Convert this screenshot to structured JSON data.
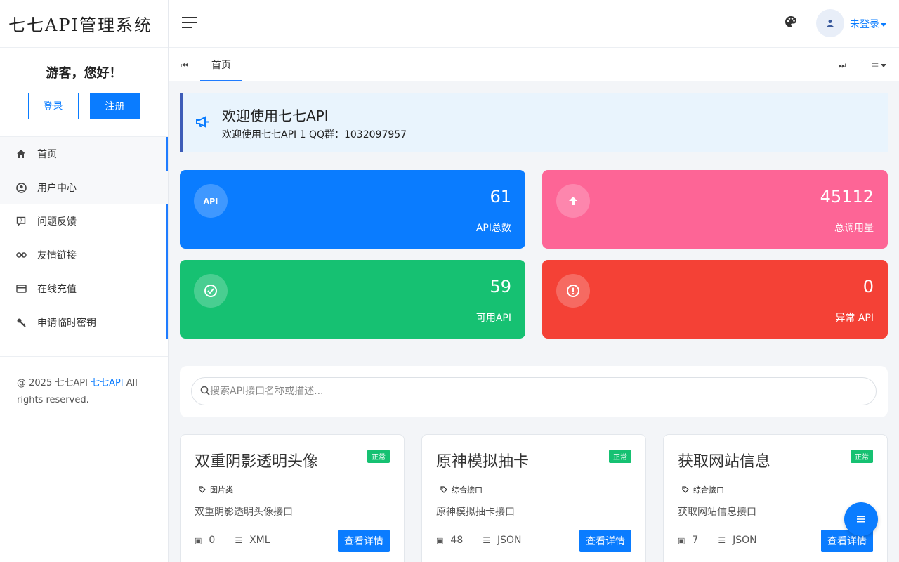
{
  "app": {
    "title": "七七API管理系统"
  },
  "sidebar": {
    "greeting": "游客，您好！",
    "login_label": "登录",
    "register_label": "注册",
    "items": [
      {
        "label": "首页",
        "icon": "home-icon"
      },
      {
        "label": "用户中心",
        "icon": "user-circle-icon"
      },
      {
        "label": "问题反馈",
        "icon": "feedback-icon"
      },
      {
        "label": "友情链接",
        "icon": "link-icon"
      },
      {
        "label": "在线充值",
        "icon": "credit-card-icon"
      },
      {
        "label": "申请临时密钥",
        "icon": "key-icon"
      }
    ],
    "footer": {
      "prefix": "@ 2025 七七API ",
      "link": "七七API",
      "suffix": " All rights reserved."
    }
  },
  "header": {
    "user_label": "未登录"
  },
  "tabs": {
    "home": "首页"
  },
  "welcome": {
    "title": "欢迎使用七七API",
    "subtitle": "欢迎使用七七API 1 QQ群：1032097957"
  },
  "stats": [
    {
      "value": "61",
      "label": "API总数",
      "icon_text": "API",
      "color": "#0a7cff"
    },
    {
      "value": "45112",
      "label": "总调用量",
      "color": "#fd6596"
    },
    {
      "value": "59",
      "label": "可用API",
      "color": "#16c172"
    },
    {
      "value": "0",
      "label": "异常 API",
      "color": "#f44136"
    }
  ],
  "search": {
    "placeholder": "搜索API接口名称或描述..."
  },
  "cards": [
    {
      "title": "双重阴影透明头像",
      "status": "正常",
      "tag": "图片类",
      "desc": "双重阴影透明头像接口",
      "count": "0",
      "format": "XML",
      "button": "查看详情"
    },
    {
      "title": "原神模拟抽卡",
      "status": "正常",
      "tag": "综合接口",
      "desc": "原神模拟抽卡接口",
      "count": "48",
      "format": "JSON",
      "button": "查看详情"
    },
    {
      "title": "获取网站信息",
      "status": "正常",
      "tag": "综合接口",
      "desc": "获取网站信息接口",
      "count": "7",
      "format": "JSON",
      "button": "查看详情"
    }
  ]
}
